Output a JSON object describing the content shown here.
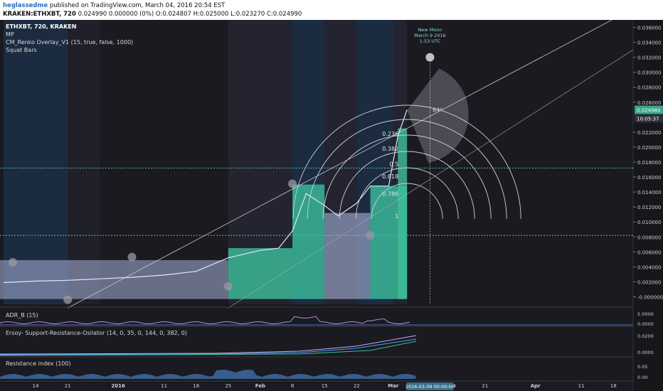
{
  "header": {
    "author": "heglassedme",
    "published": "published on TradingView.com, March 04, 2016 20:54 EST",
    "symbol_line": "KRAKEN:ETHXBT, 720",
    "quote": "0.024990 0.000000 (0%) O:0.024807 H:0.025000 L:0.023270 C:0.024990"
  },
  "legend": {
    "symbol": "ETHXBT, 720, KRAKEN",
    "items": [
      "MP",
      "CM_Renko Overlay_V1 (15, true, false, 1000)",
      "Squat Bars"
    ]
  },
  "annotation": {
    "moon": [
      "New Moon",
      "March 9 2016",
      "1:53 UTC"
    ],
    "angle": "64°",
    "fib_levels": [
      "0.236",
      "0.382",
      "0.5",
      "0.618",
      "0.786",
      "1"
    ]
  },
  "price_tags": {
    "last": "0.024980",
    "countdown": "10:05:37"
  },
  "panes": {
    "adr": {
      "title": "ADR_B (15)",
      "ticks": [
        "5.0000",
        "0.0000"
      ]
    },
    "ersoy": {
      "title": "Ersoy- Support-Resistance-Osilator (14, 0, 35, 0, 144, 0, 382, 0)",
      "ticks": [
        "0.0200",
        "0.0000"
      ]
    },
    "resist": {
      "title": "Resistance index (100)",
      "ticks": [
        "0.05",
        "0.00"
      ]
    }
  },
  "time_axis": {
    "labels": [
      "14",
      "21",
      "2016",
      "11",
      "18",
      "25",
      "Feb",
      "8",
      "15",
      "22",
      "Mar",
      "14",
      "21",
      "Apr",
      "11",
      "18"
    ],
    "cursor_label": "2016-03-09 00:00:00"
  },
  "colors": {
    "background": "#1a1a20",
    "band_blue": "#1c2c40",
    "renko_up": "#3dbf9c",
    "renko_down": "#a9b4da",
    "dotted": "#5fbfae",
    "accent_tag": "#3aa58a"
  },
  "chart_data": {
    "type": "line",
    "ylim": [
      -0.001,
      0.037
    ],
    "y_ticks": [
      0.036,
      0.034,
      0.032,
      0.03,
      0.028,
      0.026,
      0.022,
      0.02,
      0.018,
      0.016,
      0.014,
      0.012,
      0.01,
      0.008,
      0.006,
      0.004,
      0.002,
      0.0
    ],
    "y_tick_labels": [
      "0.036000",
      "0.034000",
      "0.032000",
      "0.030000",
      "0.028000",
      "0.026000",
      "0.022000",
      "0.020000",
      "0.018000",
      "0.016000",
      "0.014000",
      "0.012000",
      "0.010000",
      "0.008000",
      "0.006000",
      "0.004000",
      "0.002000",
      "-0.000000"
    ],
    "last_value": 0.02498,
    "x_dates": [
      "2015-12-07",
      "2015-12-14",
      "2015-12-21",
      "2015-12-28",
      "2016-01-04",
      "2016-01-11",
      "2016-01-18",
      "2016-01-25",
      "2016-02-01",
      "2016-02-05",
      "2016-02-08",
      "2016-02-11",
      "2016-02-15",
      "2016-02-18",
      "2016-02-22",
      "2016-02-25",
      "2016-02-29",
      "2016-03-02",
      "2016-03-04"
    ],
    "close": [
      0.0019,
      0.0021,
      0.0022,
      0.0024,
      0.0026,
      0.0029,
      0.0034,
      0.0052,
      0.0062,
      0.0065,
      0.0088,
      0.0138,
      0.0122,
      0.0108,
      0.0125,
      0.0148,
      0.0148,
      0.0215,
      0.02499
    ],
    "horizontal_levels": [
      0.0172,
      0.0082
    ],
    "renko_steps": [
      {
        "x0": "2016-01-25",
        "x1": "2016-02-08",
        "top": 0.0065,
        "kind": "up"
      },
      {
        "x0": "2016-02-08",
        "x1": "2016-02-15",
        "top": 0.015,
        "kind": "up"
      },
      {
        "x0": "2016-02-15",
        "x1": "2016-02-25",
        "top": 0.0112,
        "kind": "down"
      },
      {
        "x0": "2016-02-25",
        "x1": "2016-03-04",
        "top": 0.0148,
        "kind": "up"
      },
      {
        "x0": "2016-03-02",
        "x1": "2016-03-04",
        "top": 0.0225,
        "kind": "up"
      }
    ]
  }
}
